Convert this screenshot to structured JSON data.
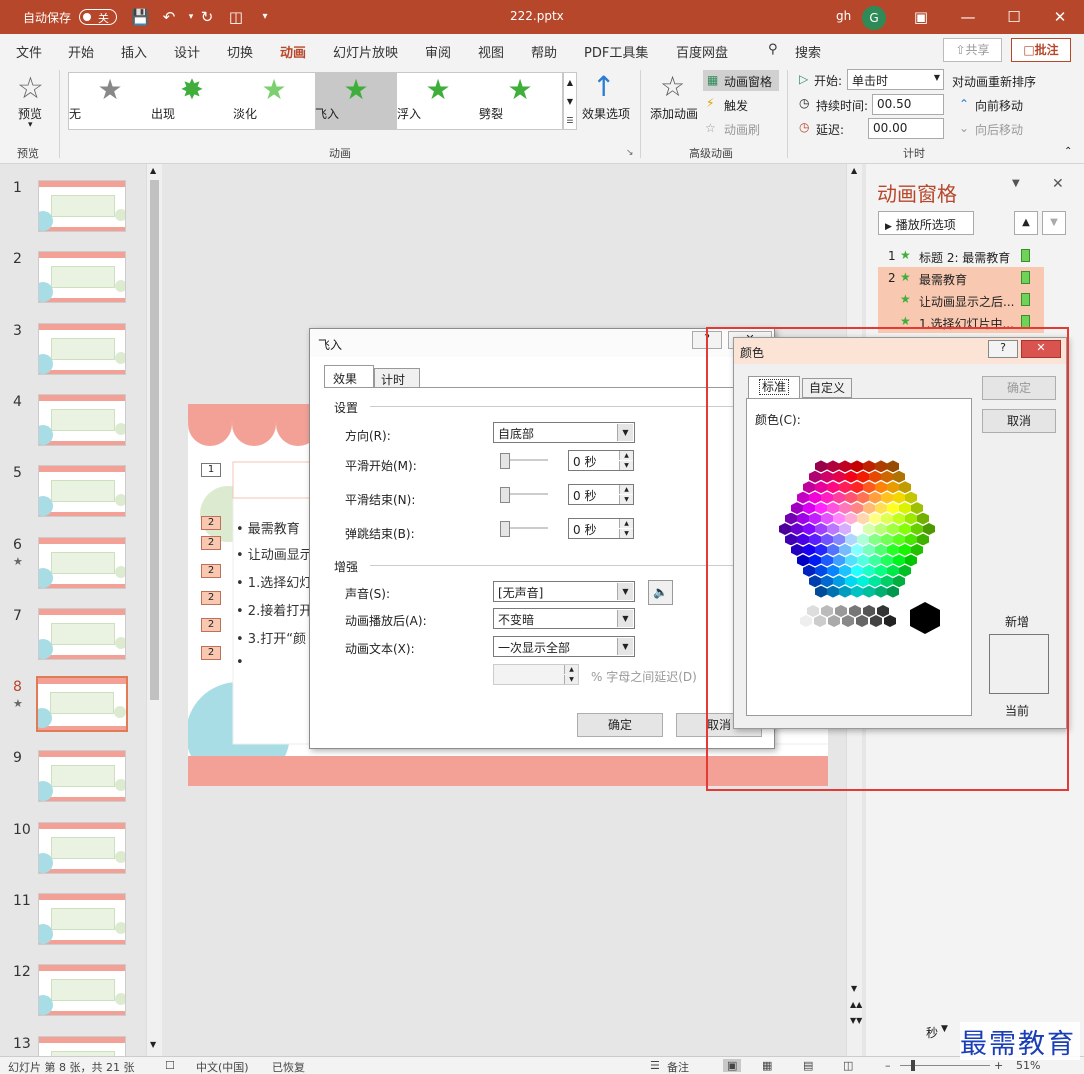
{
  "titlebar": {
    "autosave_label": "自动保存",
    "autosave_state": "关",
    "filename": "222.pptx",
    "user": "gh",
    "avatar_letter": "G"
  },
  "menu": {
    "items": [
      "文件",
      "开始",
      "插入",
      "设计",
      "切换",
      "动画",
      "幻灯片放映",
      "审阅",
      "视图",
      "帮助",
      "PDF工具集",
      "百度网盘"
    ],
    "active": "动画",
    "search": "搜索",
    "share": "共享",
    "comment": "批注"
  },
  "ribbon": {
    "preview_label": "预览",
    "preview_group": "预览",
    "gallery": [
      "无",
      "出现",
      "淡化",
      "飞入",
      "浮入",
      "劈裂"
    ],
    "effect_options": "效果选项",
    "animation_group": "动画",
    "add_animation": "添加动画",
    "animation_pane": "动画窗格",
    "trigger": "触发",
    "animation_painter": "动画刷",
    "advanced_group": "高级动画",
    "start_label": "开始:",
    "start_value": "单击时",
    "duration_label": "持续时间:",
    "duration_value": "00.50",
    "delay_label": "延迟:",
    "delay_value": "00.00",
    "timing_group": "计时",
    "reorder_label": "对动画重新排序",
    "move_earlier": "向前移动",
    "move_later": "向后移动"
  },
  "thumbnails": [
    "1",
    "2",
    "3",
    "4",
    "5",
    "6",
    "7",
    "8",
    "9",
    "10",
    "11",
    "12",
    "13"
  ],
  "selected_thumbnail": "8",
  "slide": {
    "badge1": "1",
    "badges": [
      "2",
      "2",
      "2",
      "2",
      "2",
      "2"
    ],
    "bullets": [
      "最需教育",
      "让动画显示",
      "1.选择幻灯",
      "2.接着打开",
      "3.打开“颜",
      ""
    ]
  },
  "anim_pane": {
    "title": "动画窗格",
    "play_button": "播放所选项",
    "items": [
      {
        "num": "1",
        "text": "标题 2: 最需教育"
      },
      {
        "num": "2",
        "text": "最需教育"
      },
      {
        "num": "",
        "text": "让动画显示之后..."
      },
      {
        "num": "",
        "text": "1.选择幻灯片中..."
      }
    ],
    "seconds_label": "秒"
  },
  "flyin_dialog": {
    "title": "飞入",
    "tabs": [
      "效果",
      "计时"
    ],
    "settings_header": "设置",
    "direction_label": "方向(R):",
    "direction_value": "自底部",
    "smooth_start_label": "平滑开始(M):",
    "smooth_start_value": "0 秒",
    "smooth_end_label": "平滑结束(N):",
    "smooth_end_value": "0 秒",
    "bounce_end_label": "弹跳结束(B):",
    "bounce_end_value": "0 秒",
    "enhance_header": "增强",
    "sound_label": "声音(S):",
    "sound_value": "[无声音]",
    "after_anim_label": "动画播放后(A):",
    "after_anim_value": "不变暗",
    "anim_text_label": "动画文本(X):",
    "anim_text_value": "一次显示全部",
    "letter_delay_label": "% 字母之间延迟(D)",
    "ok": "确定",
    "cancel": "取消"
  },
  "color_dialog": {
    "title": "颜色",
    "tabs": [
      "标准",
      "自定义"
    ],
    "colors_label": "颜色(C):",
    "ok": "确定",
    "cancel": "取消",
    "new_label": "新增",
    "current_label": "当前"
  },
  "statusbar": {
    "slide_info": "幻灯片 第 8 张，共 21 张",
    "language": "中文(中国)",
    "recovered": "已恢复",
    "notes": "备注",
    "zoom": "51%"
  },
  "watermark": "最需教育"
}
